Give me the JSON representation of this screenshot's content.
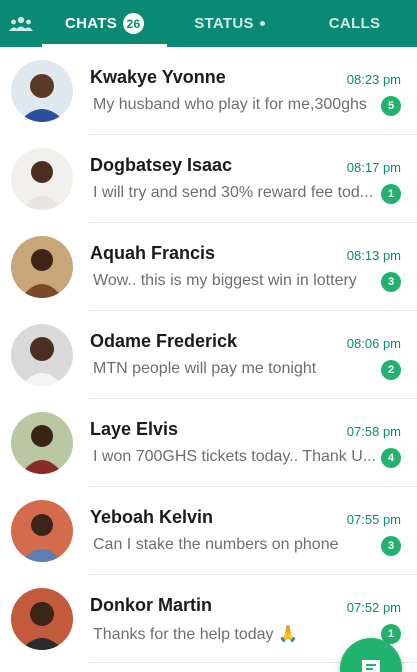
{
  "tabs": {
    "camera_icon": "people-icon",
    "chats_label": "CHATS",
    "chats_count": "26",
    "status_label": "STATUS",
    "calls_label": "CALLS"
  },
  "colors": {
    "header": "#0a8a74",
    "accent": "#21b36d",
    "time": "#0a8a74"
  },
  "chats": [
    {
      "name": "Kwakye Yvonne",
      "time": "08:23 pm",
      "preview": "My husband who play it for me,300ghs",
      "unread": "5"
    },
    {
      "name": "Dogbatsey Isaac",
      "time": "08:17 pm",
      "preview": "I will try and send 30% reward fee tod...",
      "unread": "1"
    },
    {
      "name": "Aquah Francis",
      "time": "08:13 pm",
      "preview": "Wow.. this is my biggest win in lottery",
      "unread": "3"
    },
    {
      "name": "Odame Frederick",
      "time": "08:06 pm",
      "preview": "MTN people will pay me tonight",
      "unread": "2"
    },
    {
      "name": "Laye Elvis",
      "time": "07:58 pm",
      "preview": "I won 700GHS tickets today.. Thank U...",
      "unread": "4"
    },
    {
      "name": "Yeboah Kelvin",
      "time": "07:55 pm",
      "preview": "Can I stake the numbers on phone",
      "unread": "3"
    },
    {
      "name": "Donkor Martin",
      "time": "07:52 pm",
      "preview": "Thanks for the help today 🙏",
      "unread": "1"
    }
  ],
  "fab": {
    "icon": "new-chat-icon"
  }
}
